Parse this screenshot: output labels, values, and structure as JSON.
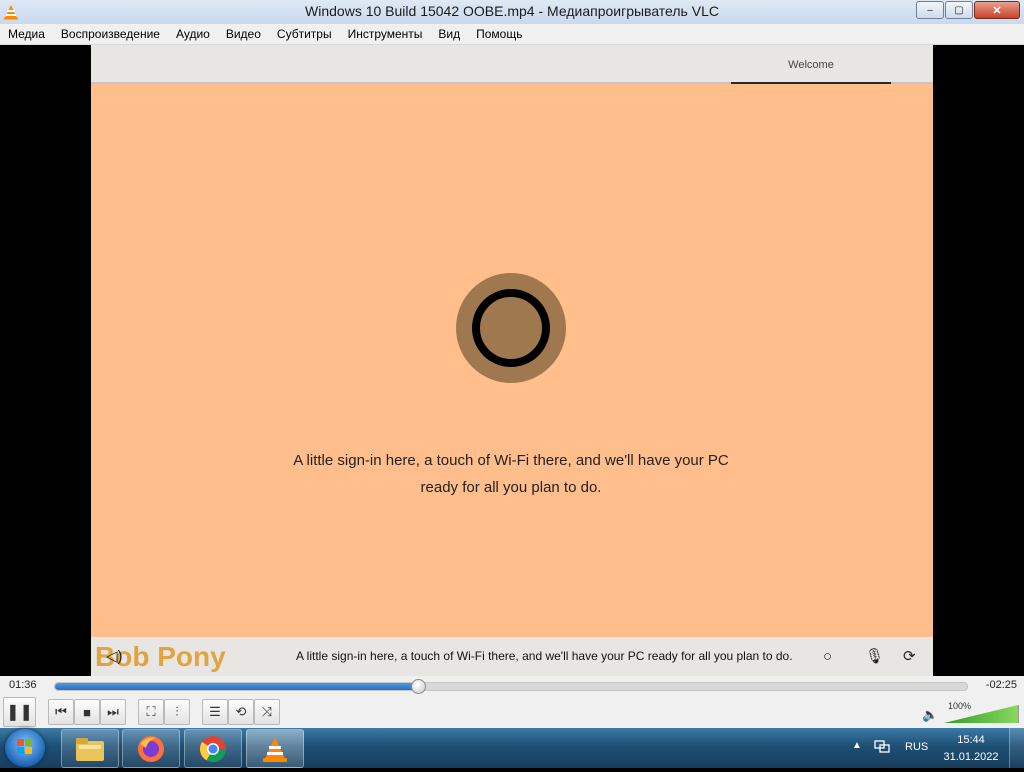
{
  "window": {
    "title": "Windows 10 Build 15042 OOBE.mp4 - Медиапроигрыватель VLC",
    "minimize": "‒",
    "maximize": "▢",
    "close": "✕"
  },
  "menu": [
    "Медиа",
    "Воспроизведение",
    "Аудио",
    "Видео",
    "Субтитры",
    "Инструменты",
    "Вид",
    "Помощь"
  ],
  "video_frame": {
    "header_tab": "Welcome",
    "message_line1": "A little sign-in here, a touch of Wi-Fi there, and we'll have your PC",
    "message_line2": "ready for all you plan to do.",
    "watermark": "Bob Pony",
    "bottom_caption": "A little sign-in here, a touch of Wi-Fi there, and we'll have your PC ready for all you plan to do.",
    "background_color": "#ffbe8c"
  },
  "playback": {
    "elapsed": "01:36",
    "remaining": "-02:25",
    "progress": 0.398
  },
  "controls": {
    "pause": "❚❚",
    "prev": "⏮",
    "stop": "■",
    "next": "⏭",
    "fullscreen": "⛶",
    "extended": "⫶",
    "playlist": "☰",
    "loop": "⟲",
    "shuffle": "⤨"
  },
  "volume": {
    "percent_label": "100%",
    "level": 1.0
  },
  "taskbar": {
    "apps": [
      "folder-icon",
      "firefox-icon",
      "chrome-icon",
      "vlc-icon"
    ],
    "language": "RUS",
    "time": "15:44",
    "date": "31.01.2022"
  },
  "colors": {
    "accent": "#2a6fbf",
    "vlc_orange": "#ff8800"
  }
}
